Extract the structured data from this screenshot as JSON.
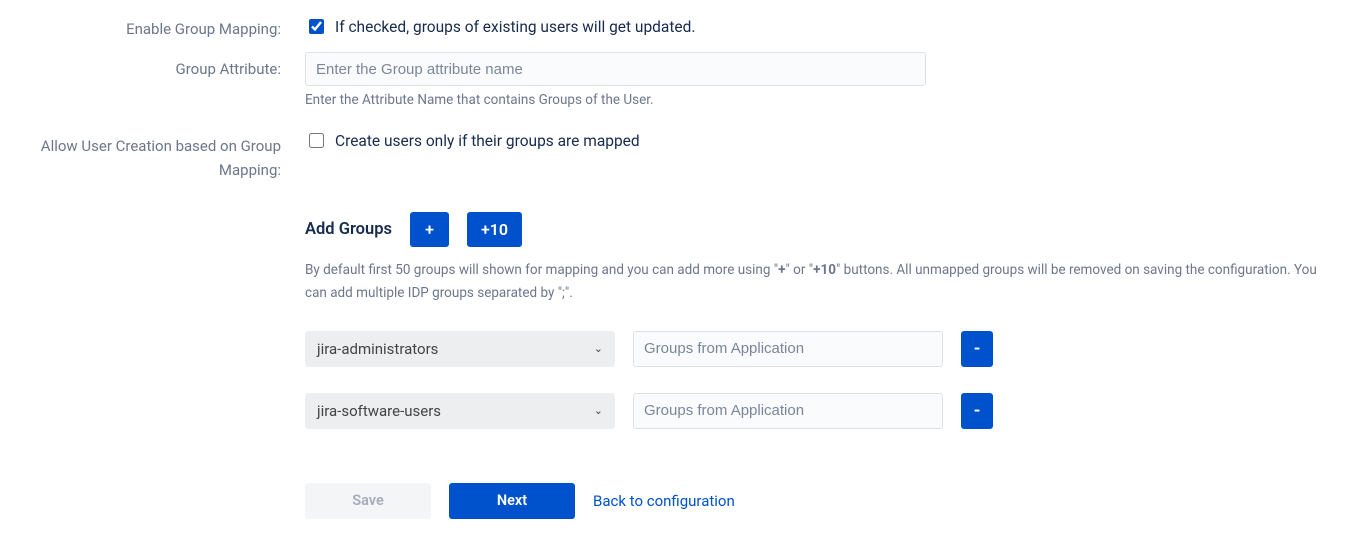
{
  "fields": {
    "enable_group_mapping": {
      "label": "Enable Group Mapping:",
      "checked": true,
      "text": "If checked, groups of existing users will get updated."
    },
    "group_attribute": {
      "label": "Group Attribute:",
      "placeholder": "Enter the Group attribute name",
      "hint": "Enter the Attribute Name that contains Groups of the User."
    },
    "allow_user_creation": {
      "label": "Allow User Creation based on Group Mapping:",
      "checked": false,
      "text": "Create users only if their groups are mapped"
    }
  },
  "add_groups": {
    "title": "Add Groups",
    "plus_label": "+",
    "plus10_label": "+10",
    "desc_pre": "By default first 50 groups will shown for mapping and you can add more using \"",
    "desc_b1": "+",
    "desc_mid": "\" or \"",
    "desc_b2": "+10",
    "desc_post": "\" buttons. All unmapped groups will be removed on saving the configuration. You can add multiple IDP groups separated by \";\"."
  },
  "groups": [
    {
      "selected": "jira-administrators",
      "placeholder": "Groups from Application"
    },
    {
      "selected": "jira-software-users",
      "placeholder": "Groups from Application"
    }
  ],
  "footer": {
    "save": "Save",
    "next": "Next",
    "back": "Back to configuration"
  },
  "misc": {
    "remove_label": "-",
    "caret": "⌄"
  }
}
